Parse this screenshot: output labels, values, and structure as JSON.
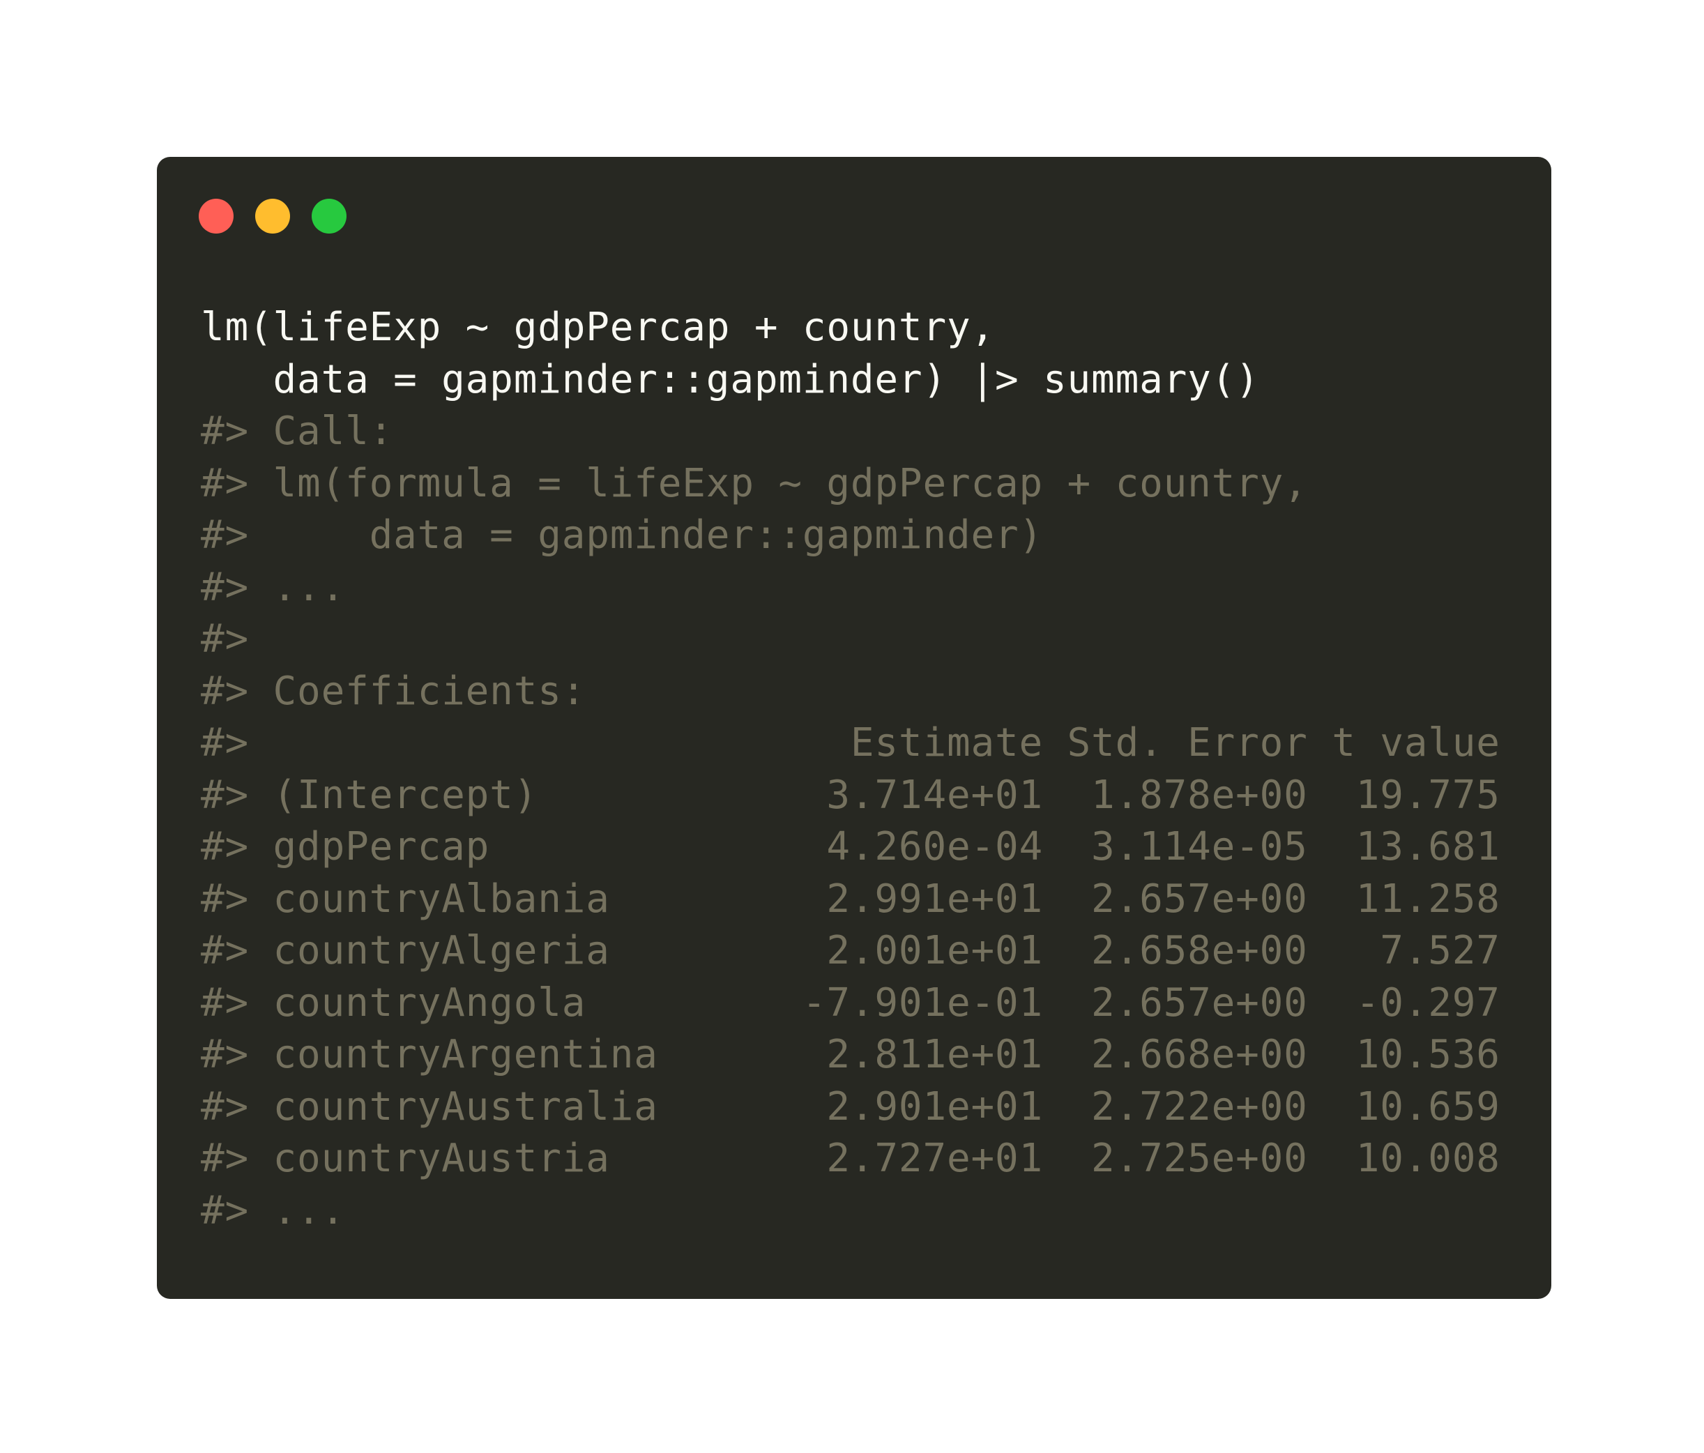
{
  "window": {
    "buttons": {
      "close_color": "#ff5f56",
      "minimize_color": "#ffbd2e",
      "maximize_color": "#27c93f"
    },
    "background": "#272822"
  },
  "code": {
    "input_color": "#f8f8f2",
    "output_color": "#75715e",
    "lines": [
      {
        "kind": "input",
        "text": "lm(lifeExp ~ gdpPercap + country,"
      },
      {
        "kind": "input",
        "text": "   data = gapminder::gapminder) |> summary()"
      },
      {
        "kind": "output",
        "text": "#> Call:"
      },
      {
        "kind": "output",
        "text": "#> lm(formula = lifeExp ~ gdpPercap + country,"
      },
      {
        "kind": "output",
        "text": "#>     data = gapminder::gapminder)"
      },
      {
        "kind": "output",
        "text": "#> ..."
      },
      {
        "kind": "output",
        "text": "#>"
      },
      {
        "kind": "output",
        "text": "#> Coefficients:"
      },
      {
        "kind": "output",
        "text": "#>                         Estimate Std. Error t value"
      },
      {
        "kind": "output",
        "text": "#> (Intercept)            3.714e+01  1.878e+00  19.775"
      },
      {
        "kind": "output",
        "text": "#> gdpPercap              4.260e-04  3.114e-05  13.681"
      },
      {
        "kind": "output",
        "text": "#> countryAlbania         2.991e+01  2.657e+00  11.258"
      },
      {
        "kind": "output",
        "text": "#> countryAlgeria         2.001e+01  2.658e+00   7.527"
      },
      {
        "kind": "output",
        "text": "#> countryAngola         -7.901e-01  2.657e+00  -0.297"
      },
      {
        "kind": "output",
        "text": "#> countryArgentina       2.811e+01  2.668e+00  10.536"
      },
      {
        "kind": "output",
        "text": "#> countryAustralia       2.901e+01  2.722e+00  10.659"
      },
      {
        "kind": "output",
        "text": "#> countryAustria         2.727e+01  2.725e+00  10.008"
      },
      {
        "kind": "output",
        "text": "#> ..."
      }
    ]
  }
}
